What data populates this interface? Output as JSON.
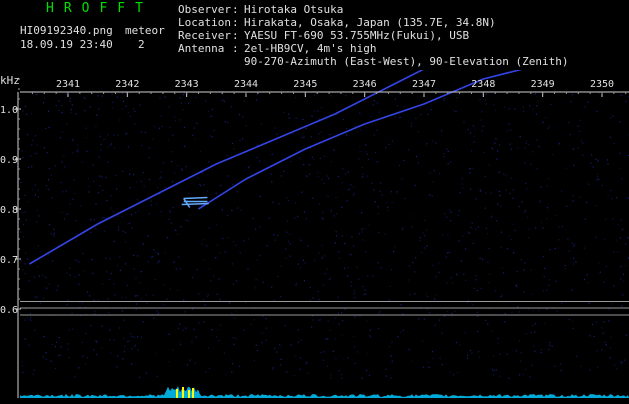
{
  "app": {
    "brand": "HROFFT",
    "filename": "HI09192340.png",
    "timestamp": "18.09.19 23:40",
    "meteor_label": "meteor",
    "meteor_count": "2"
  },
  "station": {
    "observer_key": "Observer",
    "observer": "Hirotaka Otsuka",
    "location_key": "Location",
    "location": "Hirakata, Osaka, Japan (135.7E, 34.8N)",
    "receiver_key": "Receiver",
    "receiver": "YAESU FT-690 53.755MHz(Fukui), USB",
    "antenna_key": "Antenna",
    "antenna": "2el-HB9CV, 4m's high",
    "antenna_2": "90-270-Azimuth (East-West), 90-Elevation (Zenith)"
  },
  "chart_data": {
    "type": "spectrogram",
    "ylabel": "kHz",
    "x_ticks": [
      "2341",
      "2342",
      "2343",
      "2344",
      "2345",
      "2346",
      "2347",
      "2348",
      "2349",
      "2350"
    ],
    "y_ticks": [
      "1.1",
      "1.0",
      "0.9",
      "0.8",
      "0.7",
      "0.6"
    ],
    "ylim": [
      0.58,
      1.19
    ],
    "xlim": [
      2340.3,
      2350.5
    ],
    "traces": [
      {
        "name": "",
        "x": [
          2340.35,
          2341.5,
          2342.5,
          2343.5,
          2344.5,
          2345.5,
          2346.5,
          2347.5,
          2347.8
        ],
        "y": [
          0.69,
          0.77,
          0.83,
          0.89,
          0.94,
          0.99,
          1.05,
          1.11,
          1.13
        ]
      },
      {
        "name": "",
        "x": [
          2343.2,
          2344.0,
          2345.0,
          2346.0,
          2347.0,
          2348.0,
          2349.0,
          2350.0,
          2350.45
        ],
        "y": [
          0.8,
          0.86,
          0.92,
          0.97,
          1.01,
          1.06,
          1.09,
          1.12,
          1.14
        ]
      }
    ],
    "meteor_echo": {
      "x": [
        2342.95,
        2343.35
      ],
      "y": 0.815
    },
    "horizontal_lines": [
      0.615,
      0.602,
      0.588
    ],
    "grid": false
  },
  "colors": {
    "brand": "#00e000",
    "text": "#e0e0e0",
    "trace": "#3a4cff",
    "echo": "#66aaff",
    "noise": "#1d2a9c",
    "baseline": "#00c8ff",
    "peak": "#ffff00"
  }
}
